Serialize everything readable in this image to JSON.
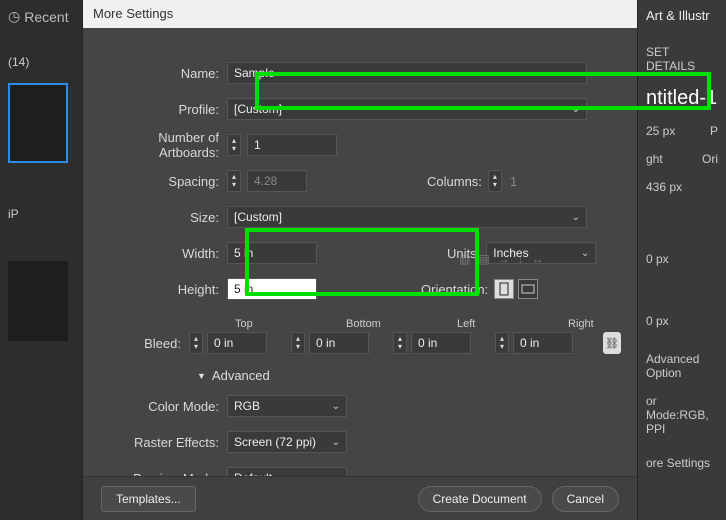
{
  "left": {
    "recent": "Recent",
    "count": "(14)",
    "ip_label": "iP"
  },
  "right": {
    "title": "Art & Illustr",
    "details": "SET DETAILS",
    "doc": "ntitled-1",
    "wlabel": "25 px",
    "p": "P",
    "hlabel": "ght",
    "hval": "436 px",
    "ori": "Ori",
    "zero1": "0 px",
    "zero2": "0 px",
    "adv": "Advanced Option",
    "mode": "or Mode:RGB, PPI",
    "more": "ore Settings"
  },
  "dialog": {
    "title": "More Settings",
    "name_label": "Name:",
    "name_value": "Sample",
    "profile_label": "Profile:",
    "profile_value": "[Custom]",
    "artboards_label": "Number of Artboards:",
    "artboards_value": "1",
    "spacing_label": "Spacing:",
    "spacing_value": "4.28",
    "columns_label": "Columns:",
    "columns_value": "1",
    "size_label": "Size:",
    "size_value": "[Custom]",
    "width_label": "Width:",
    "width_value": "5 in",
    "units_label": "Units:",
    "units_value": "Inches",
    "height_label": "Height:",
    "height_value": "5 in",
    "orient_label": "Orientation:",
    "bleed_label": "Bleed:",
    "top": "Top",
    "bottom": "Bottom",
    "left": "Left",
    "right": "Right",
    "bleed_val": "0 in",
    "advanced": "Advanced",
    "color_label": "Color Mode:",
    "color_value": "RGB",
    "raster_label": "Raster Effects:",
    "raster_value": "Screen (72 ppi)",
    "preview_label": "Preview Mode:",
    "preview_value": "Default",
    "templates": "Templates...",
    "create": "Create Document",
    "cancel": "Cancel"
  }
}
